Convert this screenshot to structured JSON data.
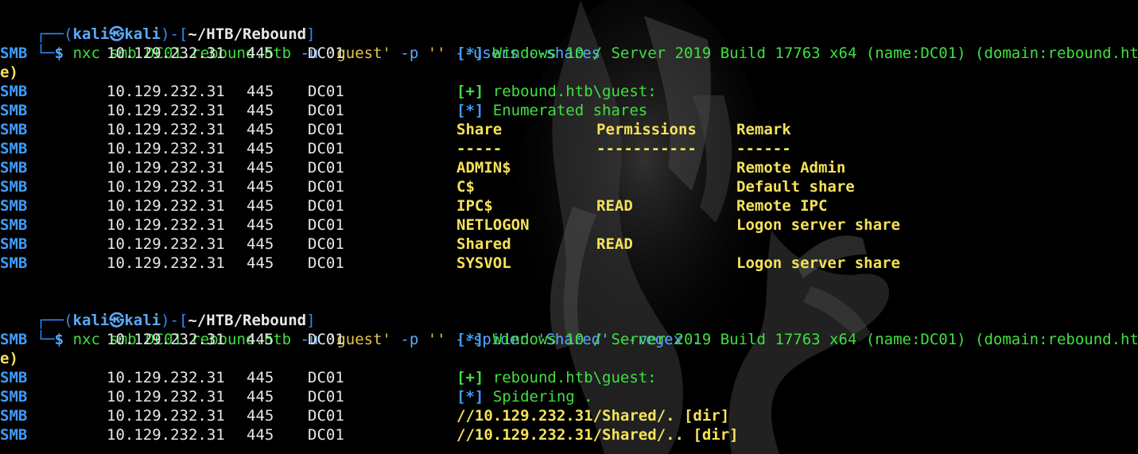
{
  "prompt": {
    "frame_top": "┌──(",
    "user": "kali",
    "at": "㉿",
    "host": "kali",
    "sep": ")-[",
    "path": "~/HTB/Rebound",
    "close": "]",
    "frame_bottom": "└─",
    "dollar": "$"
  },
  "commands": [
    {
      "tool": "nxc",
      "args_before": " smb DC01.rebound.htb ",
      "u_flag": "-u",
      "user_val": " 'guest' ",
      "p_flag": "-p",
      "pass_val": " '' ",
      "rest": "--users --shares"
    },
    {
      "tool": "nxc",
      "args_before": " smb DC01.rebound.htb ",
      "u_flag": "-u",
      "user_val": " 'guest' ",
      "p_flag": "-p",
      "pass_val": " '' ",
      "rest": "--spider 'Shared' --regex ."
    }
  ],
  "smb": {
    "proto": "SMB",
    "ip": "10.129.232.31",
    "port": "445",
    "host": "DC01"
  },
  "block1": {
    "info_star": "[*]",
    "info_text": " Windows 10 / Server 2019 Build 17763 x64 (name:DC01) (domain:rebound.htb)",
    "wrap": "e)",
    "auth_plus": "[+]",
    "auth_text": " rebound.htb\\guest:",
    "enum_star": "[*]",
    "enum_text": " Enumerated shares",
    "headers": [
      "Share",
      "Permissions",
      "Remark"
    ],
    "dashes": [
      "-----",
      "-----------",
      "------"
    ],
    "shares": [
      {
        "name": "ADMIN$",
        "perm": "",
        "remark": "Remote Admin"
      },
      {
        "name": "C$",
        "perm": "",
        "remark": "Default share"
      },
      {
        "name": "IPC$",
        "perm": "READ",
        "remark": "Remote IPC"
      },
      {
        "name": "NETLOGON",
        "perm": "",
        "remark": "Logon server share"
      },
      {
        "name": "Shared",
        "perm": "READ",
        "remark": ""
      },
      {
        "name": "SYSVOL",
        "perm": "",
        "remark": "Logon server share"
      }
    ]
  },
  "block2": {
    "info_star": "[*]",
    "info_text": " Windows 10 / Server 2019 Build 17763 x64 (name:DC01) (domain:rebound.htb)",
    "wrap": "e)",
    "auth_plus": "[+]",
    "auth_text": " rebound.htb\\guest:",
    "spider_star": "[*]",
    "spider_text": " Spidering .",
    "paths": [
      "//10.129.232.31/Shared/. [dir]",
      "//10.129.232.31/Shared/.. [dir]"
    ]
  }
}
